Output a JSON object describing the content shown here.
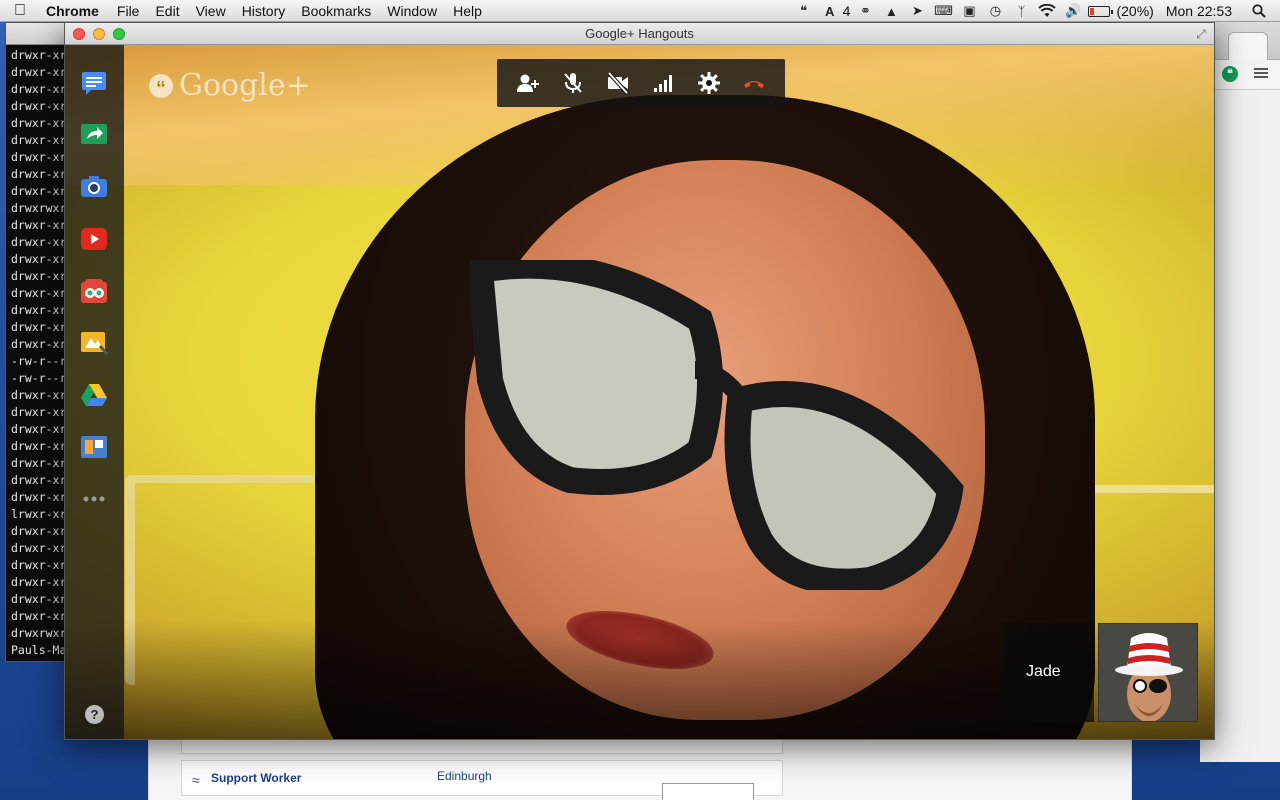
{
  "menubar": {
    "app_name": "Chrome",
    "menus": [
      "File",
      "Edit",
      "View",
      "History",
      "Bookmarks",
      "Window",
      "Help"
    ],
    "status_count": "4",
    "battery_text": "(20%)",
    "battery_level_percent": 20,
    "clock": "Mon 22:53"
  },
  "terminal": {
    "lines": [
      "drwxr-xr",
      "drwxr-xr",
      "drwxr-xr",
      "drwxr-xr",
      "drwxr-xr",
      "drwxr-xr",
      "drwxr-xr",
      "drwxr-xr",
      "drwxr-xr",
      "drwxrwxr",
      "drwxr-xr",
      "drwxr-xr",
      "drwxr-xr",
      "drwxr-xr",
      "drwxr-xr",
      "drwxr-xr",
      "drwxr-xr",
      "drwxr-xr",
      "-rw-r--r",
      "-rw-r--r",
      "drwxr-xr",
      "drwxr-xr",
      "drwxr-xr",
      "drwxr-xr",
      "drwxr-xr",
      "drwxr-xr",
      "drwxr-xr",
      "lrwxr-xr",
      "drwxr-xr",
      "drwxr-xr",
      "drwxr-xr",
      "drwxr-xr",
      "drwxr-xr",
      "drwxr-xr",
      "drwxrwxr",
      "Pauls-Ma"
    ]
  },
  "hangout": {
    "window_title": "Google+ Hangouts",
    "brand": "Google+",
    "participant_name": "Jade",
    "rail_icons": [
      "chat-icon",
      "share-screen-icon",
      "capture-icon",
      "youtube-icon",
      "effects-icon",
      "remote-desktop-icon",
      "drive-icon",
      "scoop-icon",
      "more-icon"
    ],
    "toolbar_icons": [
      "invite-icon",
      "mute-mic-icon",
      "camera-off-icon",
      "bandwidth-icon",
      "settings-icon",
      "hang-up-icon"
    ],
    "help_label": "?",
    "colors": {
      "hangup": "#e04b3a",
      "rail_bg": "#141414"
    }
  },
  "page_bg": {
    "job_title": "Support Worker",
    "job_location": "Edinburgh"
  }
}
